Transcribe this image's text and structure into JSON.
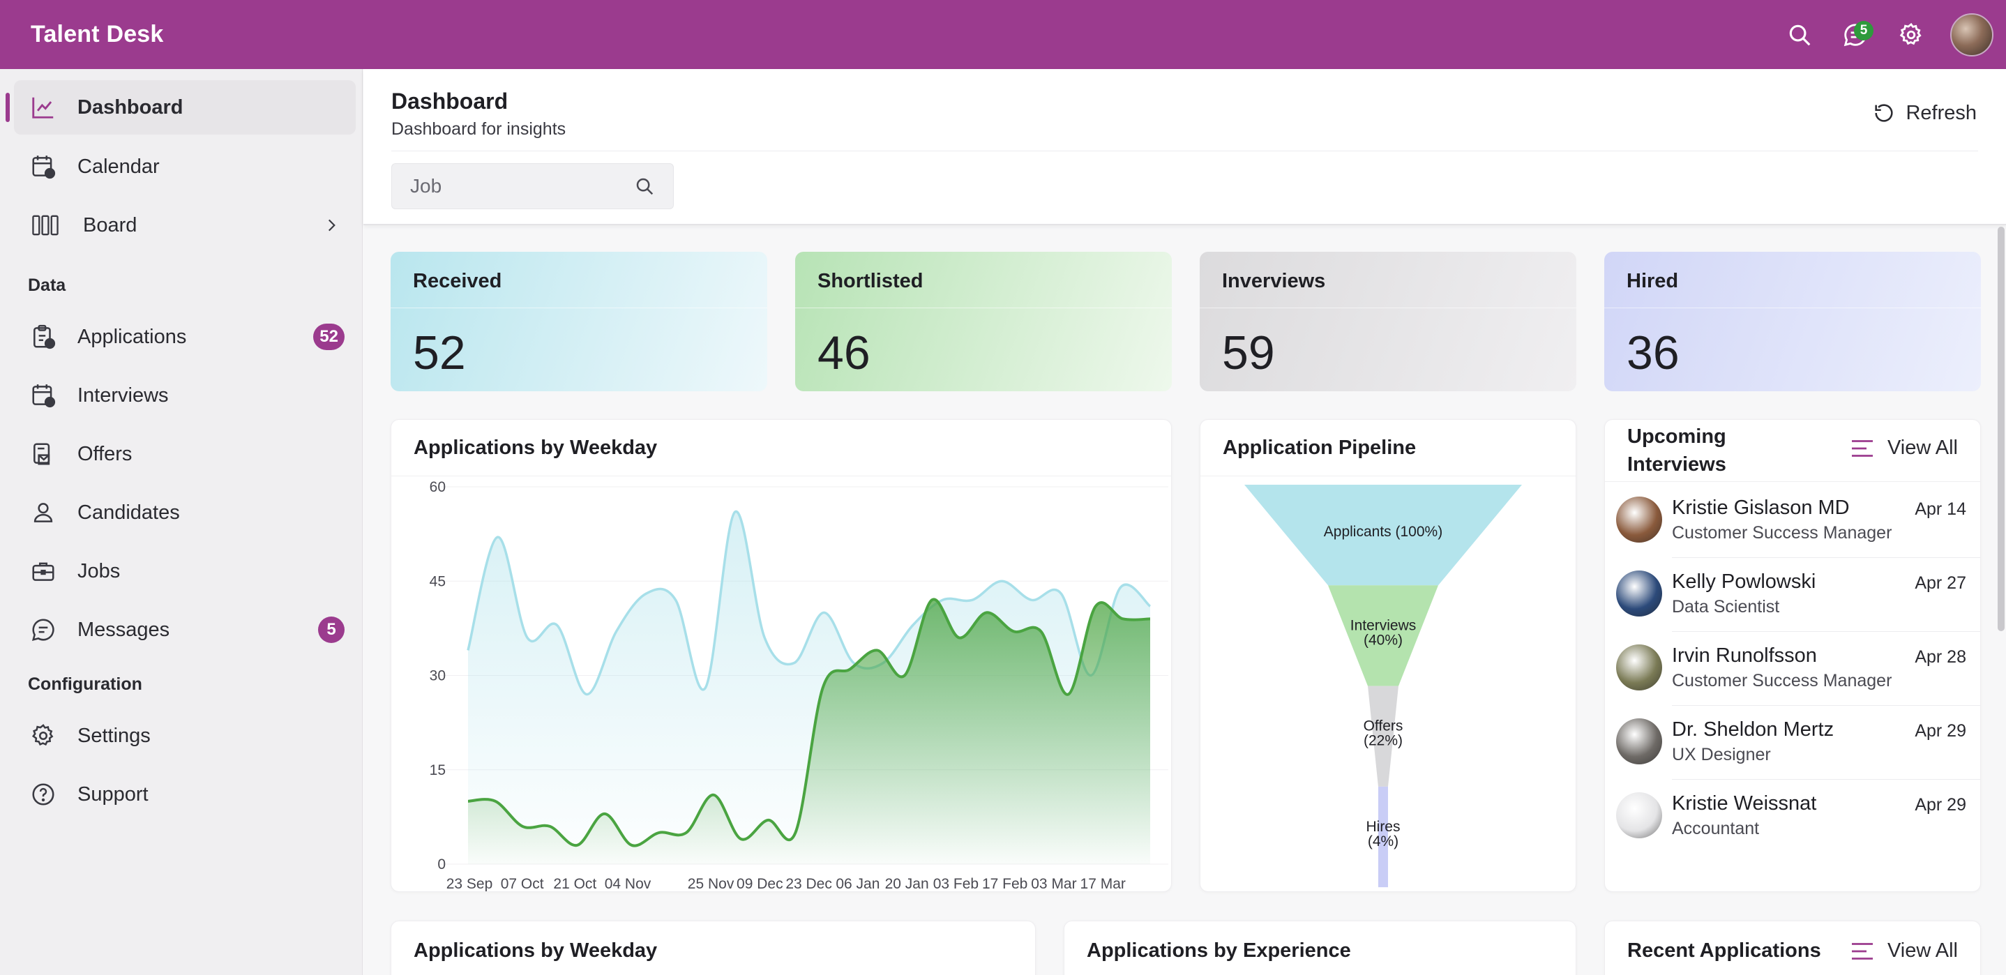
{
  "app": {
    "title": "Talent Desk",
    "messages_badge": "5"
  },
  "sidebar": {
    "items": [
      {
        "label": "Dashboard",
        "icon": "chart-line-icon",
        "active": true
      },
      {
        "label": "Calendar",
        "icon": "calendar-clock-icon"
      },
      {
        "label": "Board",
        "icon": "board-columns-icon"
      }
    ],
    "data_section": "Data",
    "data_items": [
      {
        "label": "Applications",
        "icon": "clipboard-list-icon",
        "badge": "52"
      },
      {
        "label": "Interviews",
        "icon": "calendar-clock-icon"
      },
      {
        "label": "Offers",
        "icon": "offer-envelope-icon"
      },
      {
        "label": "Candidates",
        "icon": "person-icon"
      },
      {
        "label": "Jobs",
        "icon": "briefcase-icon"
      },
      {
        "label": "Messages",
        "icon": "chat-icon",
        "badge": "5"
      }
    ],
    "config_section": "Configuration",
    "config_items": [
      {
        "label": "Settings",
        "icon": "gear-icon"
      },
      {
        "label": "Support",
        "icon": "help-circle-icon"
      }
    ]
  },
  "header": {
    "title": "Dashboard",
    "subtitle": "Dashboard for insights",
    "refresh_label": "Refresh",
    "search_placeholder": "Job"
  },
  "stats": [
    {
      "label": "Received",
      "value": "52",
      "color_from": "#b9e6ee",
      "color_to": "#eef8fb"
    },
    {
      "label": "Shortlisted",
      "value": "46",
      "color_from": "#b7e3b5",
      "color_to": "#eef8ec"
    },
    {
      "label": "Inverviews",
      "value": "59",
      "color_from": "#dcdbdd",
      "color_to": "#f0eff1"
    },
    {
      "label": "Hired",
      "value": "36",
      "color_from": "#d1d6f7",
      "color_to": "#eceffc"
    }
  ],
  "weekday_chart": {
    "title": "Applications by Weekday",
    "chart_data": {
      "type": "area",
      "x": [
        "23 Sep",
        "07 Oct",
        "21 Oct",
        "04 Nov",
        "25 Nov",
        "09 Dec",
        "23 Dec",
        "06 Jan",
        "20 Jan",
        "03 Feb",
        "17 Feb",
        "03 Mar",
        "17 Mar"
      ],
      "ylim": [
        0,
        60
      ],
      "yticks": [
        0,
        15,
        30,
        45,
        60
      ],
      "series": [
        {
          "color": "#a7dfe9",
          "values": [
            34,
            52,
            36,
            38,
            27,
            37,
            43,
            42,
            28,
            56,
            36,
            32,
            40,
            32,
            32,
            38,
            42,
            42,
            45,
            42,
            43,
            30,
            44,
            41
          ]
        },
        {
          "color": "#4aa441",
          "values": [
            10,
            10,
            6,
            6,
            3,
            8,
            3,
            5,
            5,
            11,
            4,
            7,
            5,
            28,
            31,
            34,
            30,
            42,
            36,
            40,
            37,
            37,
            27,
            41,
            39,
            39
          ]
        }
      ]
    }
  },
  "pipeline": {
    "title": "Application Pipeline",
    "chart_data": {
      "type": "funnel",
      "stages": [
        {
          "label": "Applicants (100%)",
          "value": 100,
          "color": "#b4e4ec"
        },
        {
          "label": "Interviews (40%)",
          "value": 40,
          "color": "#b4e3ae"
        },
        {
          "label": "Offers (22%)",
          "value": 22,
          "color": "#d8d8da"
        },
        {
          "label": "Hires (4%)",
          "value": 4,
          "color": "#c9cdf6"
        }
      ]
    }
  },
  "upcoming": {
    "title_line1": "Upcoming",
    "title_line2": "Interviews",
    "view_all": "View All",
    "items": [
      {
        "name": "Kristie Gislason MD",
        "role": "Customer Success Manager",
        "date": "Apr 14",
        "avatar_color": "#8a5a3c"
      },
      {
        "name": "Kelly Powlowski",
        "role": "Data Scientist",
        "date": "Apr 27",
        "avatar_color": "#2c4a7a"
      },
      {
        "name": "Irvin Runolfsson",
        "role": "Customer Success Manager",
        "date": "Apr 28",
        "avatar_color": "#7a7a55"
      },
      {
        "name": "Dr. Sheldon Mertz",
        "role": "UX Designer",
        "date": "Apr 29",
        "avatar_color": "#6e6a66"
      },
      {
        "name": "Kristie Weissnat",
        "role": "Accountant",
        "date": "Apr 29",
        "avatar_color": "#e4e4e6"
      }
    ]
  },
  "bottom": {
    "weekday_title": "Applications by Weekday",
    "experience_title": "Applications by Experience",
    "recent_title": "Recent Applications",
    "view_all": "View All"
  }
}
